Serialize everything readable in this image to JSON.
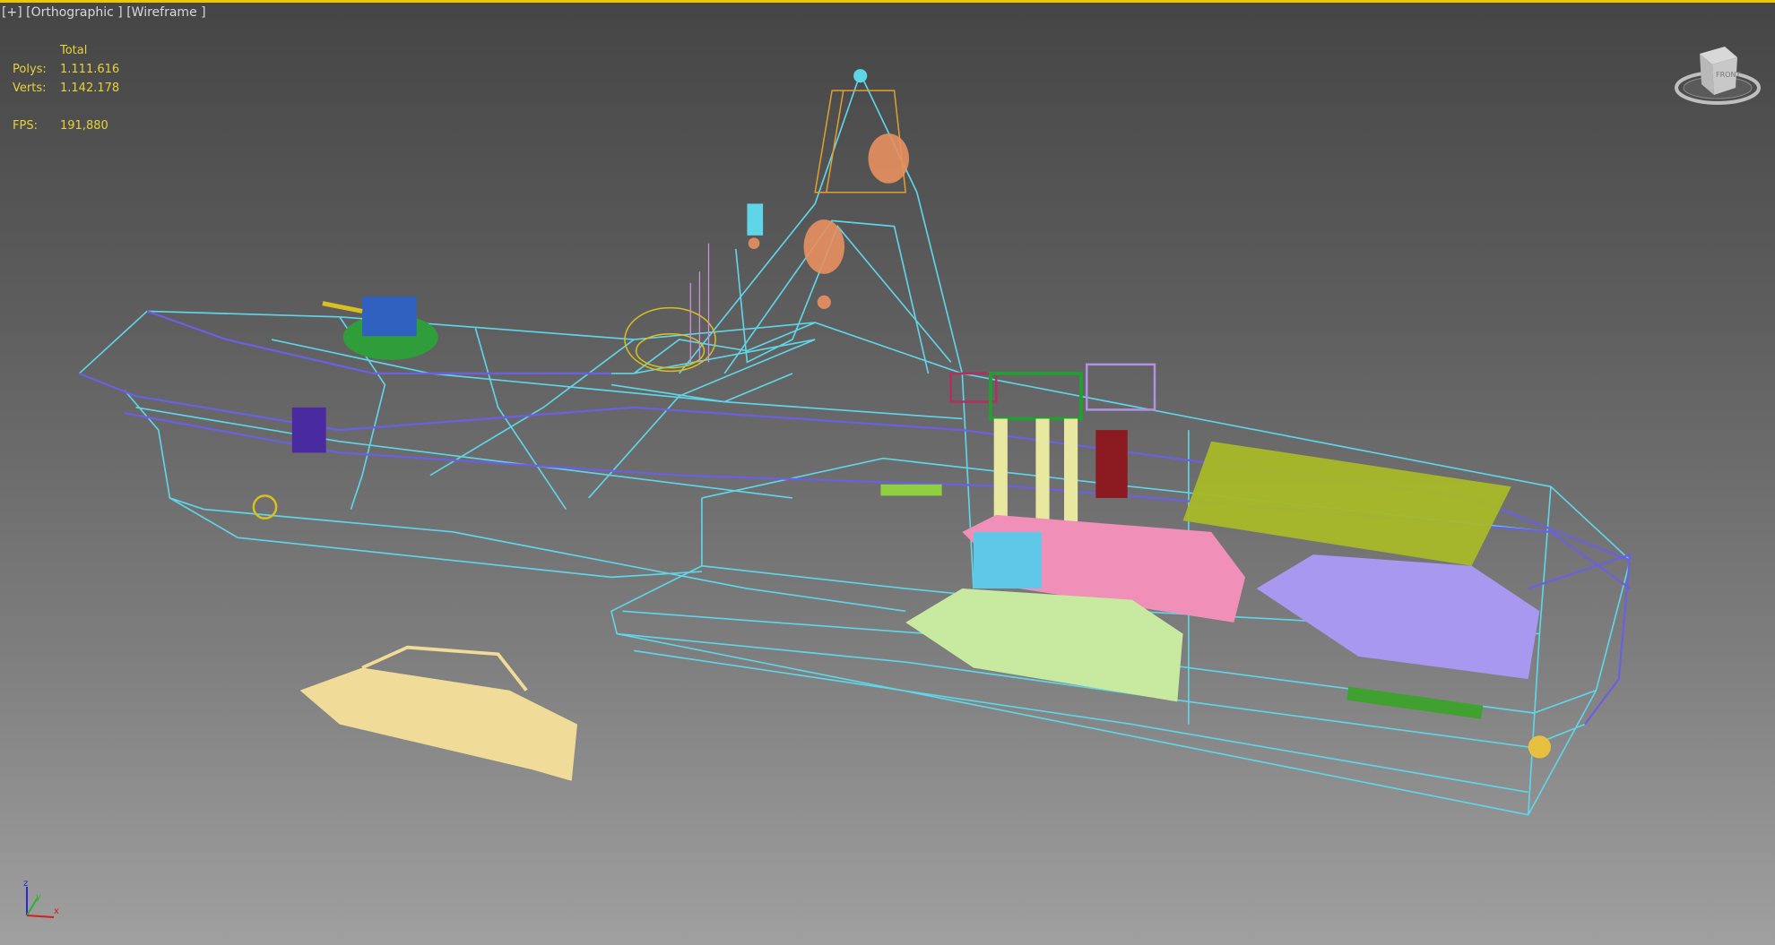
{
  "viewport": {
    "label_plus": "[+]",
    "label_view": "[Orthographic ]",
    "label_shading": "[Wireframe ]"
  },
  "stats": {
    "header": "Total",
    "polys_label": "Polys:",
    "polys_value": "1.111.616",
    "verts_label": "Verts:",
    "verts_value": "1.142.178",
    "fps_label": "FPS:",
    "fps_value": "191,880"
  },
  "viewcube": {
    "face_label": "FRONT"
  },
  "axis": {
    "x": "x",
    "y": "y",
    "z": "z"
  },
  "colors": {
    "accent_border": "#e8c800",
    "stats_text": "#e6d23a",
    "wire_cyan": "#5fd6e8",
    "wire_blue": "#6a60e0"
  }
}
